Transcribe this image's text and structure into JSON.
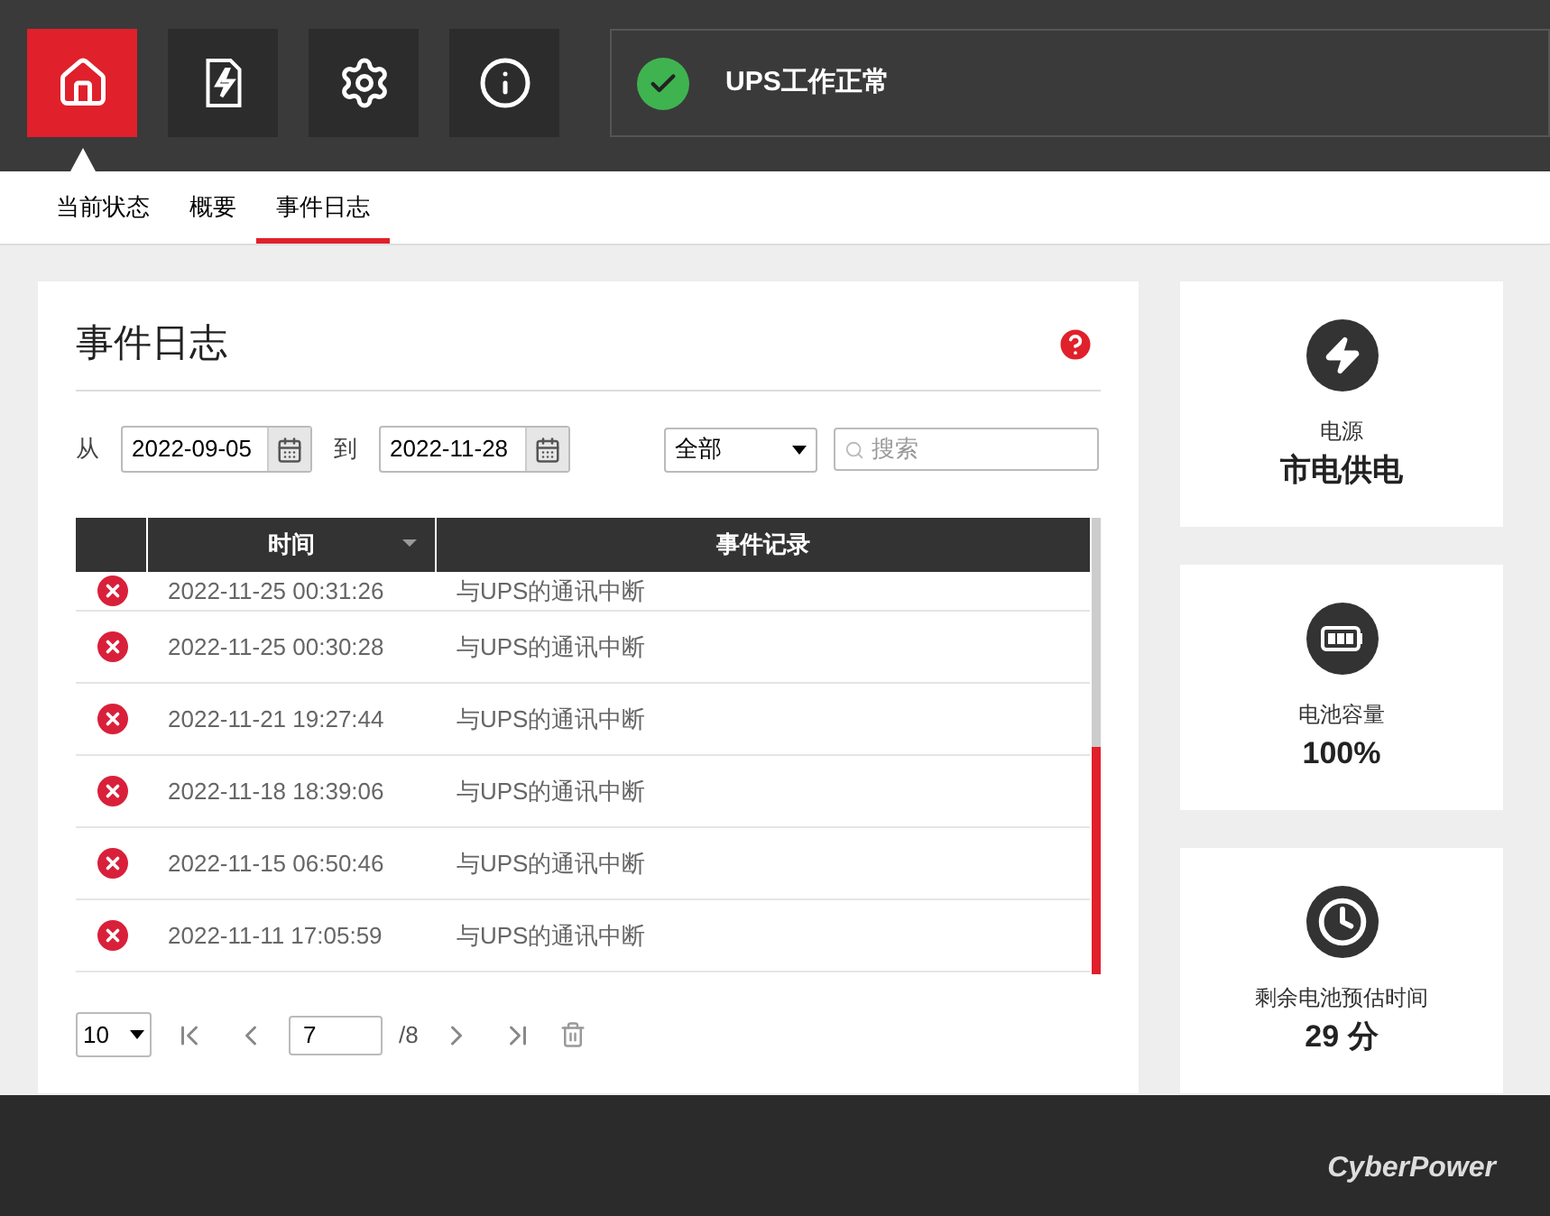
{
  "nav_buttons": [
    {
      "kind": "home",
      "selected": true
    },
    {
      "kind": "power-file",
      "selected": false
    },
    {
      "kind": "settings",
      "selected": false
    },
    {
      "kind": "info",
      "selected": false
    }
  ],
  "status": {
    "text": "UPS工作正常"
  },
  "tabs": [
    {
      "label": "当前状态",
      "selected": false
    },
    {
      "label": "概要",
      "selected": false
    },
    {
      "label": "事件日志",
      "selected": true
    }
  ],
  "event_log": {
    "title": "事件日志",
    "from_label": "从",
    "from_date": "2022-09-05",
    "to_label": "到",
    "to_date": "2022-11-28",
    "filter": "全部",
    "search": {
      "placeholder": "搜索"
    },
    "columns": [
      "",
      "时间",
      "事件记录"
    ],
    "rows": [
      {
        "time": "2022-11-25 00:31:26",
        "event": "与UPS的通讯中断",
        "partial": true
      },
      {
        "time": "2022-11-25 00:30:28",
        "event": "与UPS的通讯中断",
        "partial": false
      },
      {
        "time": "2022-11-21 19:27:44",
        "event": "与UPS的通讯中断",
        "partial": false
      },
      {
        "time": "2022-11-18 18:39:06",
        "event": "与UPS的通讯中断",
        "partial": false
      },
      {
        "time": "2022-11-15 06:50:46",
        "event": "与UPS的通讯中断",
        "partial": false
      },
      {
        "time": "2022-11-11 17:05:59",
        "event": "与UPS的通讯中断",
        "partial": false
      }
    ],
    "pagination": {
      "page_size": "10",
      "page": "7",
      "total": "/8"
    }
  },
  "cards": [
    {
      "kind": "power",
      "label": "电源",
      "value": "市电供电"
    },
    {
      "kind": "battery",
      "label": "电池容量",
      "value": "100%"
    },
    {
      "kind": "clock",
      "label": "剩余电池预估时间",
      "value": "29 分"
    }
  ],
  "footer": {
    "logo": "CyberPower"
  }
}
